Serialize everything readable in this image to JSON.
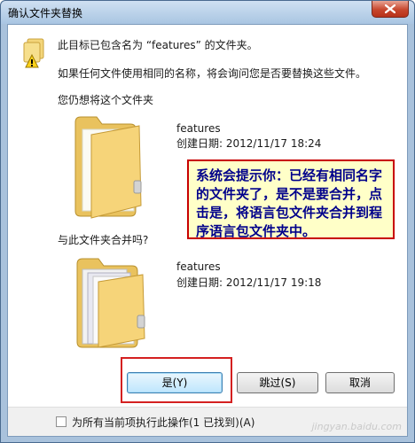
{
  "window": {
    "title": "确认文件夹替换"
  },
  "header": {
    "line1": "此目标已包含名为 “features” 的文件夹。",
    "line2": "如果任何文件使用相同的名称，将会询问您是否要替换这些文件。",
    "line3": "您仍想将这个文件夹"
  },
  "source": {
    "name": "features",
    "date": "创建日期: 2012/11/17 18:24"
  },
  "merge_question": "与此文件夹合并吗?",
  "target": {
    "name": "features",
    "date": "创建日期: 2012/11/17 19:18"
  },
  "callout": "系统会提示你：已经有相同名字的文件夹了，是不是要合并，点击是，将语言包文件夹合并到程序语言包文件夹中。",
  "buttons": {
    "yes": "是(Y)",
    "skip": "跳过(S)",
    "cancel": "取消"
  },
  "checkbox_label": "为所有当前项执行此操作(1 已找到)(A)",
  "watermark": "jingyan.baidu.com"
}
